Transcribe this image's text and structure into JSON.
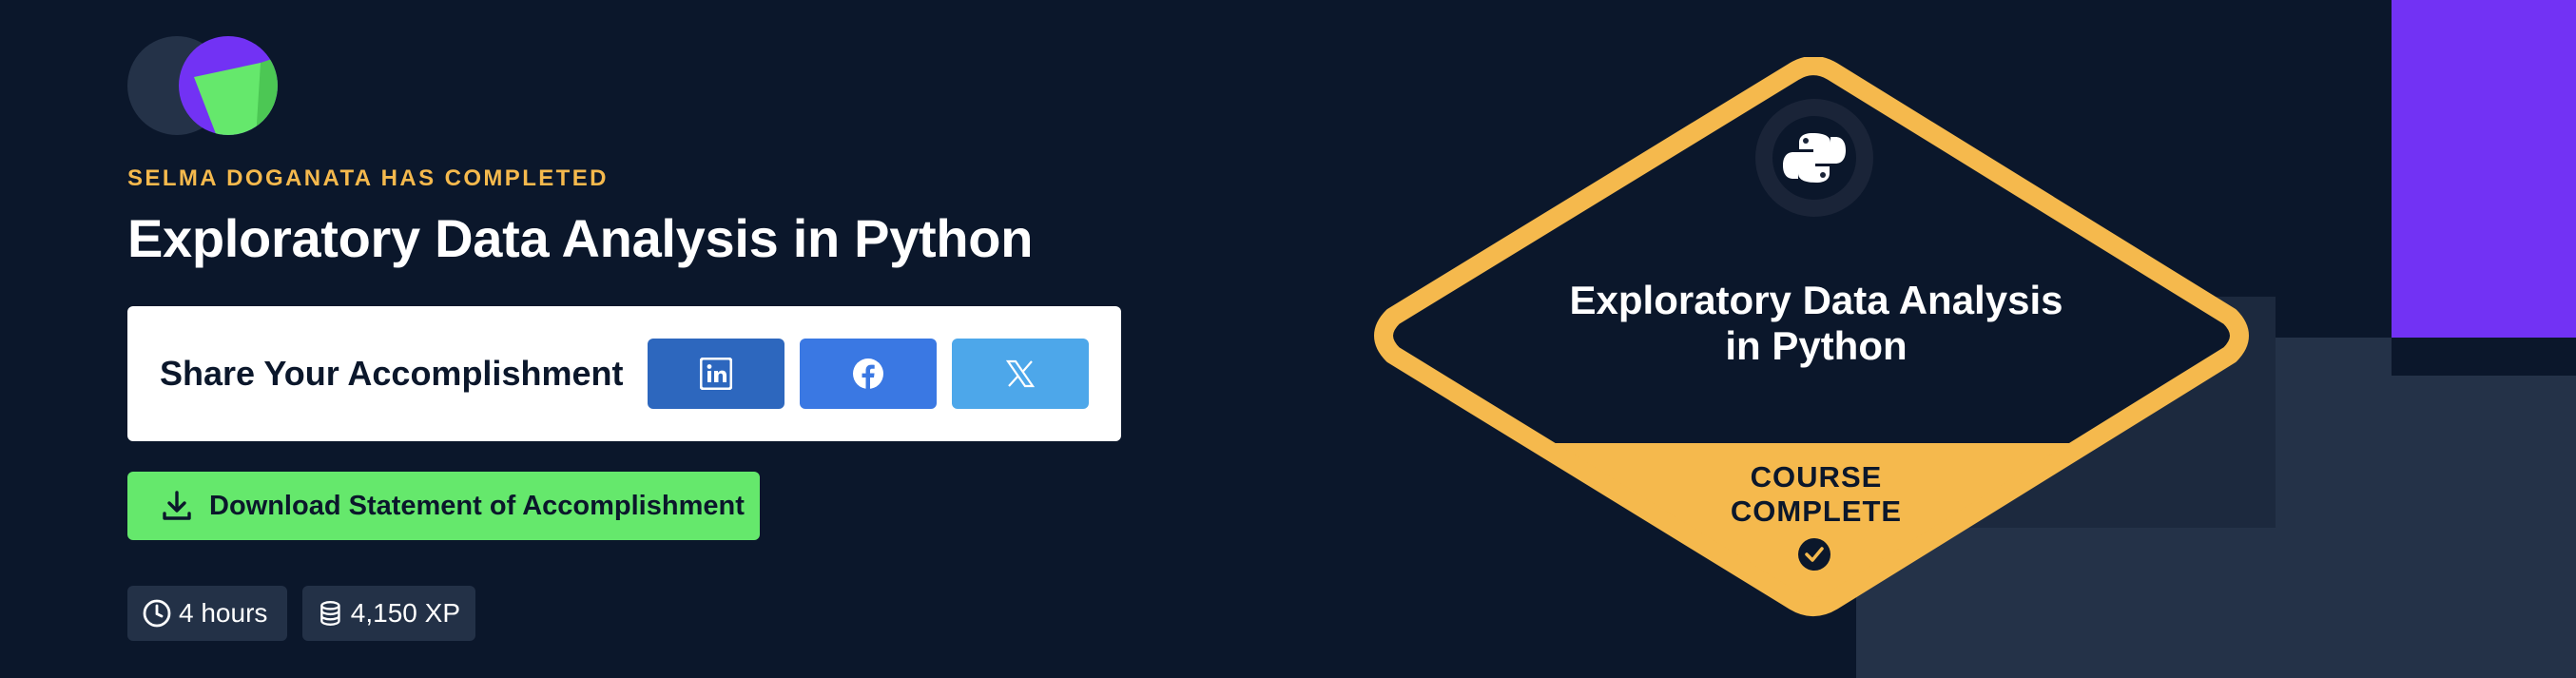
{
  "certificate": {
    "completed_label": "SELMA DOGANATA HAS COMPLETED",
    "course_title": "Exploratory Data Analysis in Python"
  },
  "share": {
    "label": "Share Your Accomplishment",
    "buttons": [
      {
        "network": "LinkedIn",
        "icon": "linkedin-icon",
        "color": "#2d67be"
      },
      {
        "network": "Facebook",
        "icon": "facebook-icon",
        "color": "#3a78e3"
      },
      {
        "network": "X",
        "icon": "x-icon",
        "color": "#4da7ea"
      }
    ]
  },
  "download": {
    "label": "Download Statement of Accomplishment",
    "icon": "download-icon",
    "color": "#65e86c"
  },
  "stats": {
    "duration": "4 hours",
    "duration_icon": "clock-icon",
    "xp": "4,150 XP",
    "xp_icon": "database-icon"
  },
  "badge": {
    "title_line1": "Exploratory Data Analysis",
    "title_line2": "in Python",
    "status_line1": "COURSE",
    "status_line2": "COMPLETE",
    "icon": "python-icon",
    "check_icon": "check-circle-icon",
    "border_color": "#f5b94d"
  },
  "colors": {
    "background": "#0b172b",
    "accent_yellow": "#f5b94d",
    "accent_purple": "#7232f4",
    "accent_green": "#65e86c"
  }
}
